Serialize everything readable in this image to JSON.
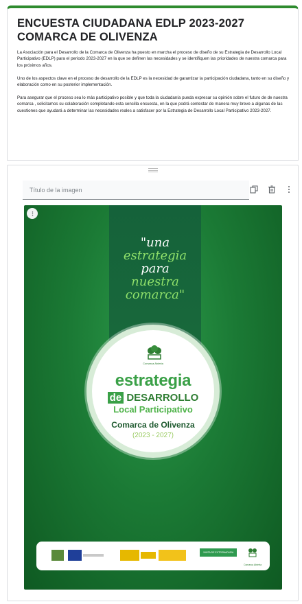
{
  "form": {
    "title": "ENCUESTA CIUDADANA EDLP 2023-2027 COMARCA DE OLIVENZA",
    "description": [
      "La Asociación para el Desarrollo de la Comarca de Olivenza ha puesto en marcha el proceso de diseño de su Estrategia de Desarrollo Local Participativo (EDLP) para el periodo 2023-2027 en la que se definen las necesidades y se identifiquen las prioridades de nuestra comarca para los próximos años.",
      "Uno de los aspectos clave en el proceso de desarrollo de la EDLP es la necesidad de garantizar la participación ciudadana, tanto en su diseño y elaboración como en su posterior implementación.",
      "Para asegurar que el proceso sea lo más participativo posible y que toda la ciudadanía pueda expresar su opinión sobre el futuro de de nuestra comarca , solicitamos su colaboración completando esta sencilla encuesta, en la que podrá contestar de manera muy breve a algunas de las cuestiones que ayudará a determinar las necesidades reales a satisfacer por la Estrategia de Desarrollo Local Participativo 2023-2027."
    ],
    "accent_color": "#2e8b2e"
  },
  "image_item": {
    "title_placeholder": "Título de la imagen",
    "icons": [
      "copy-icon",
      "delete-icon",
      "more-vert-icon"
    ],
    "image_menu_icon": "more-vert-icon"
  },
  "poster": {
    "quote": [
      "\"una",
      "estrategia",
      "para",
      "nuestra",
      "comarca\""
    ],
    "logo_caption": "Comarca Abierta",
    "line1": "estrategia",
    "line2_de": "de",
    "line2_rest": "DESARROLLO",
    "line3": "Local Participativo",
    "line4": "Comarca de Olivenza",
    "line5": "(2023 - 2027)",
    "sponsor_text": "JUNTA DE EXTREMADURA",
    "sponsor_logo_caption": "Comarca Abierta"
  }
}
